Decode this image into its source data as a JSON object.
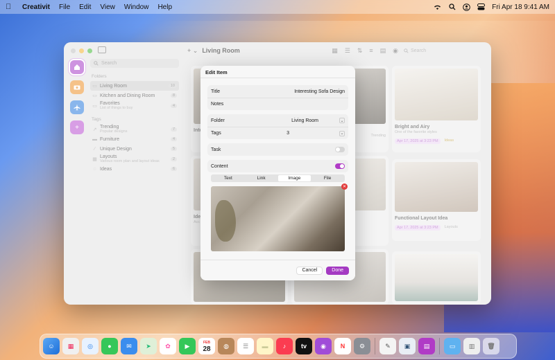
{
  "menubar": {
    "app_name": "Creativit",
    "menus": [
      "File",
      "Edit",
      "View",
      "Window",
      "Help"
    ],
    "datetime": "Fri Apr 18  9:41 AM"
  },
  "window": {
    "title": "Living Room",
    "search_placeholder": "Search"
  },
  "sidebar": {
    "search_placeholder": "Search",
    "folders_heading": "Folders",
    "folders": [
      {
        "label": "Living Room",
        "count": "10"
      },
      {
        "label": "Kitchen and Dining Room",
        "count": "8"
      },
      {
        "label": "Favorites",
        "sub": "List of things to buy",
        "count": "4"
      }
    ],
    "tags_heading": "Tags",
    "tags": [
      {
        "label": "Trending",
        "sub": "Popular designs",
        "count": "7"
      },
      {
        "label": "Furniture",
        "count": "4"
      },
      {
        "label": "Unique Design",
        "count": "5"
      },
      {
        "label": "Layouts",
        "sub": "Various room plan and layout ideas",
        "count": "2"
      },
      {
        "label": "Ideas",
        "count": "6"
      }
    ]
  },
  "cards": [
    {
      "title": "Inte",
      "sub": "",
      "date": "",
      "tag": ""
    },
    {
      "title": "",
      "sub": "",
      "date": "",
      "tag": "Trending"
    },
    {
      "title": "Bright and Airy",
      "sub": "One of the favorite styles",
      "date": "Apr 17, 2025 at 3:23 PM",
      "tag": "Ideas"
    },
    {
      "title": "Ide",
      "sub": "Acc",
      "date": "",
      "tag": ""
    },
    {
      "title": "",
      "sub": "",
      "date": "",
      "tag": ""
    },
    {
      "title": "Functional Layout Idea",
      "sub": "",
      "date": "Apr 17, 2025 at 3:23 PM",
      "tag": "Layouts"
    }
  ],
  "modal": {
    "title": "Edit Item",
    "fields": {
      "title_label": "Title",
      "title_value": "Interesting Sofa Design",
      "notes_label": "Notes",
      "folder_label": "Folder",
      "folder_value": "Living Room",
      "tags_label": "Tags",
      "tags_value": "3",
      "task_label": "Task",
      "content_label": "Content"
    },
    "segments": [
      "Text",
      "Link",
      "Image",
      "File"
    ],
    "selected_segment": "Image",
    "cancel": "Cancel",
    "done": "Done"
  },
  "dock": {
    "calendar_month": "FEB",
    "calendar_day": "28"
  },
  "colors": {
    "accent": "#a43ac2",
    "destructive": "#e23b3b"
  }
}
